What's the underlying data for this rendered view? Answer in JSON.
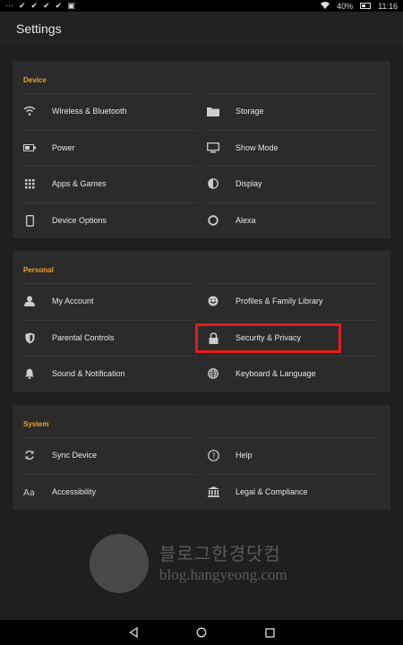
{
  "status": {
    "battery": "40%",
    "time": "11:16"
  },
  "header": {
    "title": "Settings"
  },
  "sections": {
    "device": {
      "title": "Device",
      "items": [
        {
          "label": "Wireless & Bluetooth",
          "icon": "wifi-icon"
        },
        {
          "label": "Storage",
          "icon": "folder-icon"
        },
        {
          "label": "Power",
          "icon": "battery-icon"
        },
        {
          "label": "Show Mode",
          "icon": "monitor-icon"
        },
        {
          "label": "Apps & Games",
          "icon": "grid-icon"
        },
        {
          "label": "Display",
          "icon": "contrast-icon"
        },
        {
          "label": "Device Options",
          "icon": "tablet-icon"
        },
        {
          "label": "Alexa",
          "icon": "alexa-ring-icon"
        }
      ]
    },
    "personal": {
      "title": "Personal",
      "items": [
        {
          "label": "My Account",
          "icon": "person-icon"
        },
        {
          "label": "Profiles & Family Library",
          "icon": "smiley-icon"
        },
        {
          "label": "Parental Controls",
          "icon": "shield-icon"
        },
        {
          "label": "Security & Privacy",
          "icon": "lock-icon"
        },
        {
          "label": "Sound & Notification",
          "icon": "bell-icon"
        },
        {
          "label": "Keyboard & Language",
          "icon": "globe-icon"
        }
      ]
    },
    "system": {
      "title": "System",
      "items": [
        {
          "label": "Sync Device",
          "icon": "sync-icon"
        },
        {
          "label": "Help",
          "icon": "help-icon"
        },
        {
          "label": "Accessibility",
          "icon": "font-size-icon"
        },
        {
          "label": "Legal & Compliance",
          "icon": "bank-icon"
        }
      ]
    }
  },
  "watermark": {
    "ko": "블로그한경닷컴",
    "en": "blog.hangyeong.com"
  },
  "colors": {
    "accent": "#f0a21e",
    "highlight": "#e31b1b",
    "section_bg": "#2b2b2b",
    "page_bg": "#1f1f1f"
  }
}
